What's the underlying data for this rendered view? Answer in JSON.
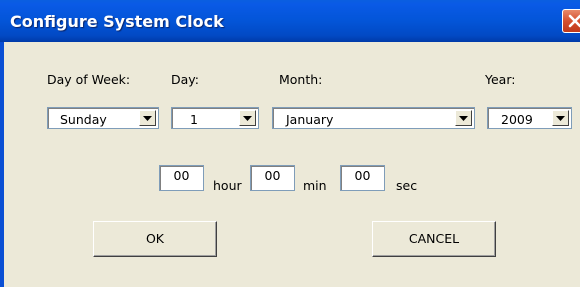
{
  "window": {
    "title": "Configure System Clock",
    "close_icon": "close-icon"
  },
  "labels": {
    "day_of_week": "Day of Week:",
    "day": "Day:",
    "month": "Month:",
    "year": "Year:"
  },
  "fields": {
    "day_of_week": "Sunday",
    "day": "1",
    "month": "January",
    "year": "2009"
  },
  "time": {
    "hour_value": "00",
    "hour_label": "hour",
    "min_value": "00",
    "min_label": "min",
    "sec_value": "00",
    "sec_label": "sec"
  },
  "buttons": {
    "ok": "OK",
    "cancel": "CANCEL"
  },
  "colors": {
    "title_bar": "#0355d8",
    "dialog_bg": "#ece9d8",
    "close_button": "#d5502f"
  }
}
